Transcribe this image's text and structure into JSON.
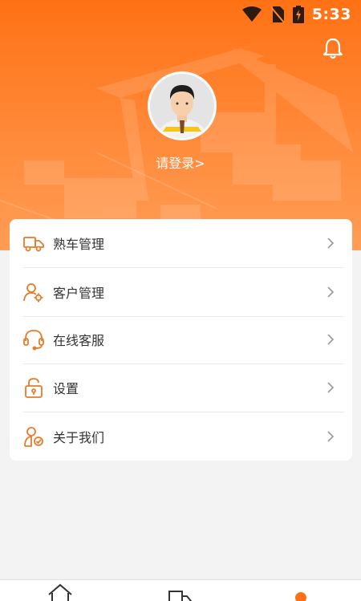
{
  "status_bar": {
    "time": "5:33"
  },
  "profile": {
    "login_text": "请登录>"
  },
  "menu": {
    "items": [
      {
        "label": "熟车管理",
        "icon": "truck-icon"
      },
      {
        "label": "客户管理",
        "icon": "user-settings-icon"
      },
      {
        "label": "在线客服",
        "icon": "headset-icon"
      },
      {
        "label": "设置",
        "icon": "lock-icon"
      },
      {
        "label": "关于我们",
        "icon": "user-check-icon"
      }
    ]
  },
  "tabbar": {
    "tabs": [
      {
        "icon": "home-icon"
      },
      {
        "icon": "truck-icon"
      },
      {
        "icon": "profile-icon"
      }
    ],
    "active_index": 2
  },
  "colors": {
    "accent": "#ff7114",
    "icon": "#e87b2a",
    "background": "#f3f3f3"
  }
}
